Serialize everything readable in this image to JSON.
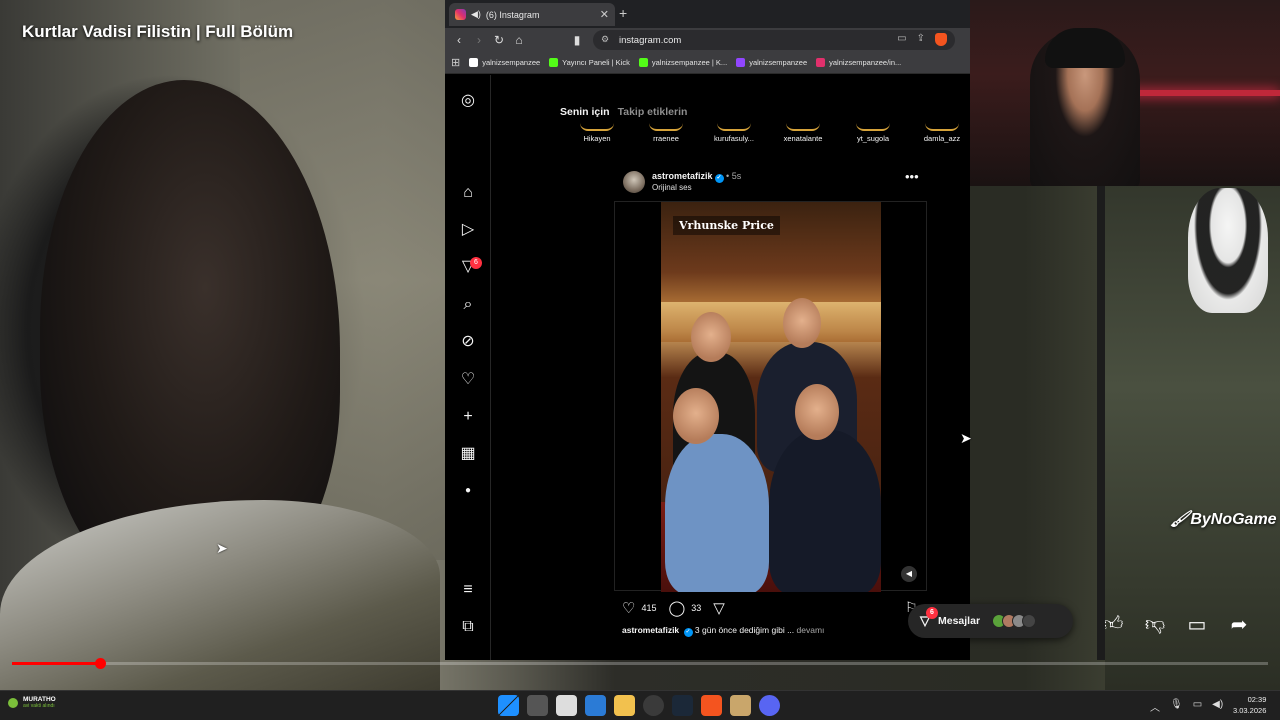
{
  "video": {
    "title": "Kurtlar Vadisi Filistin | Full Bölüm",
    "progress_percent": 7,
    "overlay_brand": "ByNoGame",
    "actions": [
      "like-icon",
      "dislike-icon",
      "comment-icon",
      "share-icon"
    ]
  },
  "browser": {
    "tab_title": "(6) Instagram",
    "url": "instagram.com",
    "bookmarks": [
      {
        "label": "yalnizsempanzee",
        "color": "#ffffff"
      },
      {
        "label": "Yayıncı Paneli | Kick",
        "color": "#53fc18"
      },
      {
        "label": "yalnizsempanzee | K...",
        "color": "#53fc18"
      },
      {
        "label": "yalnizsempanzee",
        "color": "#9146ff"
      },
      {
        "label": "yalnizsempanzee/in...",
        "color": "#e1306c"
      }
    ]
  },
  "instagram": {
    "feed_tabs": {
      "for_you": "Senin için",
      "following": "Takip etiklerin"
    },
    "stories": [
      "Hikayen",
      "rraenee",
      "kurufasuly...",
      "xenatalante",
      "yt_sugola",
      "damla_azz"
    ],
    "notification_count": "6",
    "post": {
      "username": "astrometafizik",
      "time": "5s",
      "audio": "Orijinal ses",
      "watermark": "Vrhunske Price",
      "likes": "415",
      "comments": "33",
      "caption_user": "astrometafizik",
      "caption_text": "3 gün önce dediğim gibi ...",
      "caption_more": "devamı"
    },
    "messages": {
      "label": "Mesajlar",
      "badge": "6"
    }
  },
  "taskbar": {
    "user": "MURATHO",
    "status": "avi vakti alındı",
    "time": "02:39",
    "date": "3.03.2026"
  },
  "colors": {
    "accent_red": "#ff3040",
    "verified_blue": "#0095f6",
    "brave_orange": "#f4541f"
  }
}
